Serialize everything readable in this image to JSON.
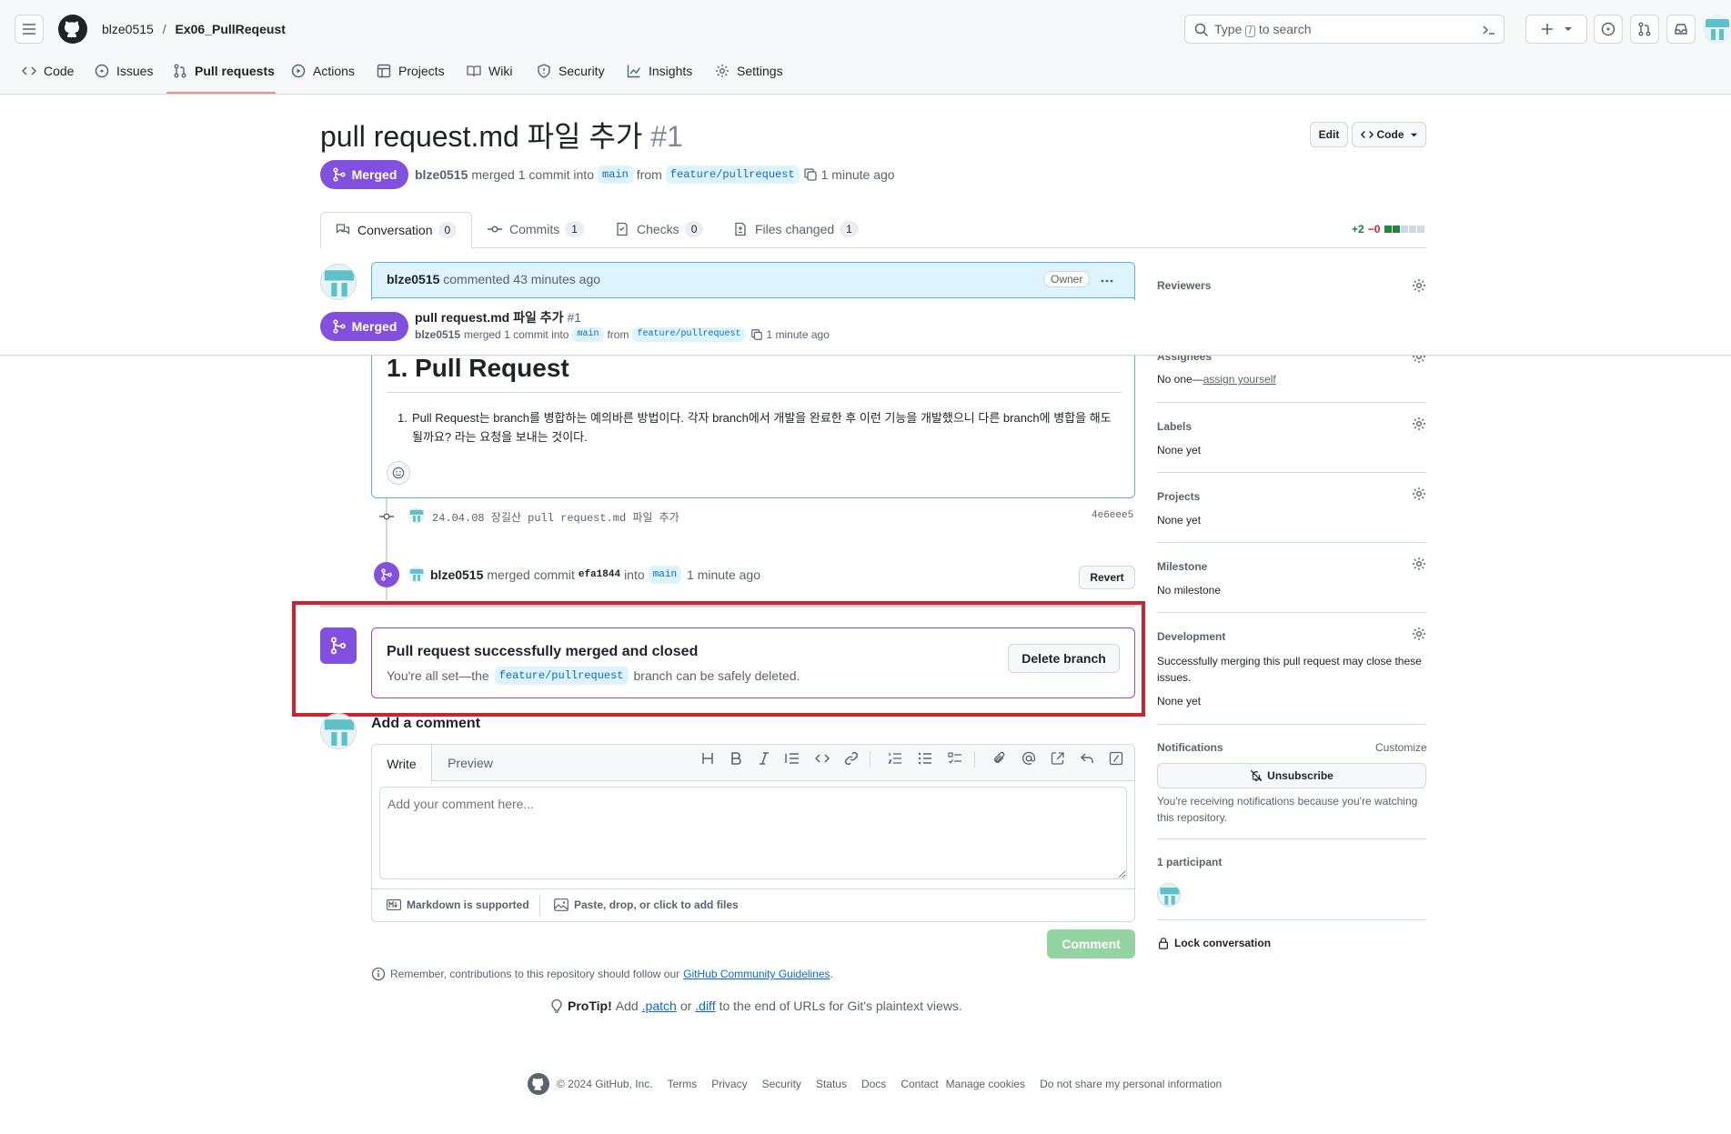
{
  "header": {
    "owner": "blze0515",
    "separator": "/",
    "repo": "Ex06_PullReqeust",
    "search_placeholder_pre": "Type",
    "search_key": "/",
    "search_placeholder_post": "to search"
  },
  "repo_nav": {
    "items": [
      {
        "label": "Code"
      },
      {
        "label": "Issues"
      },
      {
        "label": "Pull requests"
      },
      {
        "label": "Actions"
      },
      {
        "label": "Projects"
      },
      {
        "label": "Wiki"
      },
      {
        "label": "Security"
      },
      {
        "label": "Insights"
      },
      {
        "label": "Settings"
      }
    ]
  },
  "pr": {
    "title": "pull request.md 파일 추가",
    "number": "#1",
    "state": "Merged",
    "author": "blze0515",
    "merged_text": "merged 1 commit into",
    "base_branch": "main",
    "from_text": "from",
    "head_branch": "feature/pullrequest",
    "time": "1 minute ago",
    "edit_label": "Edit",
    "code_label": "Code"
  },
  "tabs": [
    {
      "label": "Conversation",
      "count": "0"
    },
    {
      "label": "Commits",
      "count": "1"
    },
    {
      "label": "Checks",
      "count": "0"
    },
    {
      "label": "Files changed",
      "count": "1"
    }
  ],
  "diffstat": {
    "added": "+2",
    "removed": "−0"
  },
  "comment": {
    "author": "blze0515",
    "action": "commented 43 minutes ago",
    "role": "Owner",
    "heading": "1. Pull Request",
    "list_marker": "1.",
    "body": "Pull Request는 branch를 병합하는 예의바른 방법이다. 각자 branch에서 개발을 완료한 후 이런 기능을 개발했으니 다른 branch에 병합을 해도 될까요? 라는 요청을 보내는 것이다."
  },
  "sticky": {
    "state": "Merged",
    "title": "pull request.md 파일 추가",
    "number": "#1",
    "author": "blze0515",
    "merged_text": "merged 1 commit into",
    "base_branch": "main",
    "from_text": "from",
    "head_branch": "feature/pullrequest",
    "time": "1 minute ago"
  },
  "commit_event": {
    "message": "24.04.08 장길산 pull request.md 파일 추가",
    "sha": "4e6eee5"
  },
  "merge_event": {
    "author": "blze0515",
    "text1": "merged commit",
    "sha": "efa1844",
    "text2": "into",
    "branch": "main",
    "time": "1 minute ago",
    "revert_label": "Revert"
  },
  "merge_box": {
    "title": "Pull request successfully merged and closed",
    "text_pre": "You're all set—the",
    "branch": "feature/pullrequest",
    "text_post": "branch can be safely deleted.",
    "delete_label": "Delete branch"
  },
  "add_comment": {
    "heading": "Add a comment",
    "tab_write": "Write",
    "tab_preview": "Preview",
    "placeholder": "Add your comment here...",
    "markdown_note": "Markdown is supported",
    "attach_note": "Paste, drop, or click to add files",
    "submit_label": "Comment"
  },
  "guidelines": {
    "text_pre": "Remember, contributions to this repository should follow our",
    "link": "GitHub Community Guidelines",
    "text_post": "."
  },
  "protip": {
    "label": "ProTip!",
    "text1": "Add",
    "patch": ".patch",
    "text2": "or",
    "diff": ".diff",
    "text3": "to the end of URLs for Git's plaintext views."
  },
  "sidebar": {
    "reviewers": {
      "label": "Reviewers"
    },
    "assignees": {
      "label": "Assignees",
      "value_pre": "No one—",
      "value_link": "assign yourself"
    },
    "labels": {
      "label": "Labels",
      "value": "None yet"
    },
    "projects": {
      "label": "Projects",
      "value": "None yet"
    },
    "milestone": {
      "label": "Milestone",
      "value": "No milestone"
    },
    "development": {
      "label": "Development",
      "text": "Successfully merging this pull request may close these issues.",
      "value": "None yet"
    },
    "notifications": {
      "label": "Notifications",
      "customize": "Customize",
      "unsubscribe": "Unsubscribe",
      "text": "You're receiving notifications because you're watching this repository."
    },
    "participants": {
      "label": "1 participant"
    },
    "lock": {
      "label": "Lock conversation"
    }
  },
  "footer": {
    "copyright": "© 2024 GitHub, Inc.",
    "links": [
      "Terms",
      "Privacy",
      "Security",
      "Status",
      "Docs",
      "Contact",
      "Manage cookies",
      "Do not share my personal information"
    ]
  },
  "colors": {
    "merged": "#8250df",
    "link": "#0969da",
    "highlight_box": "#cf222e",
    "comment_header": "#ddf4ff",
    "comment_button_disabled": "#94d3a2",
    "tab_underline": "#fd8c73"
  }
}
